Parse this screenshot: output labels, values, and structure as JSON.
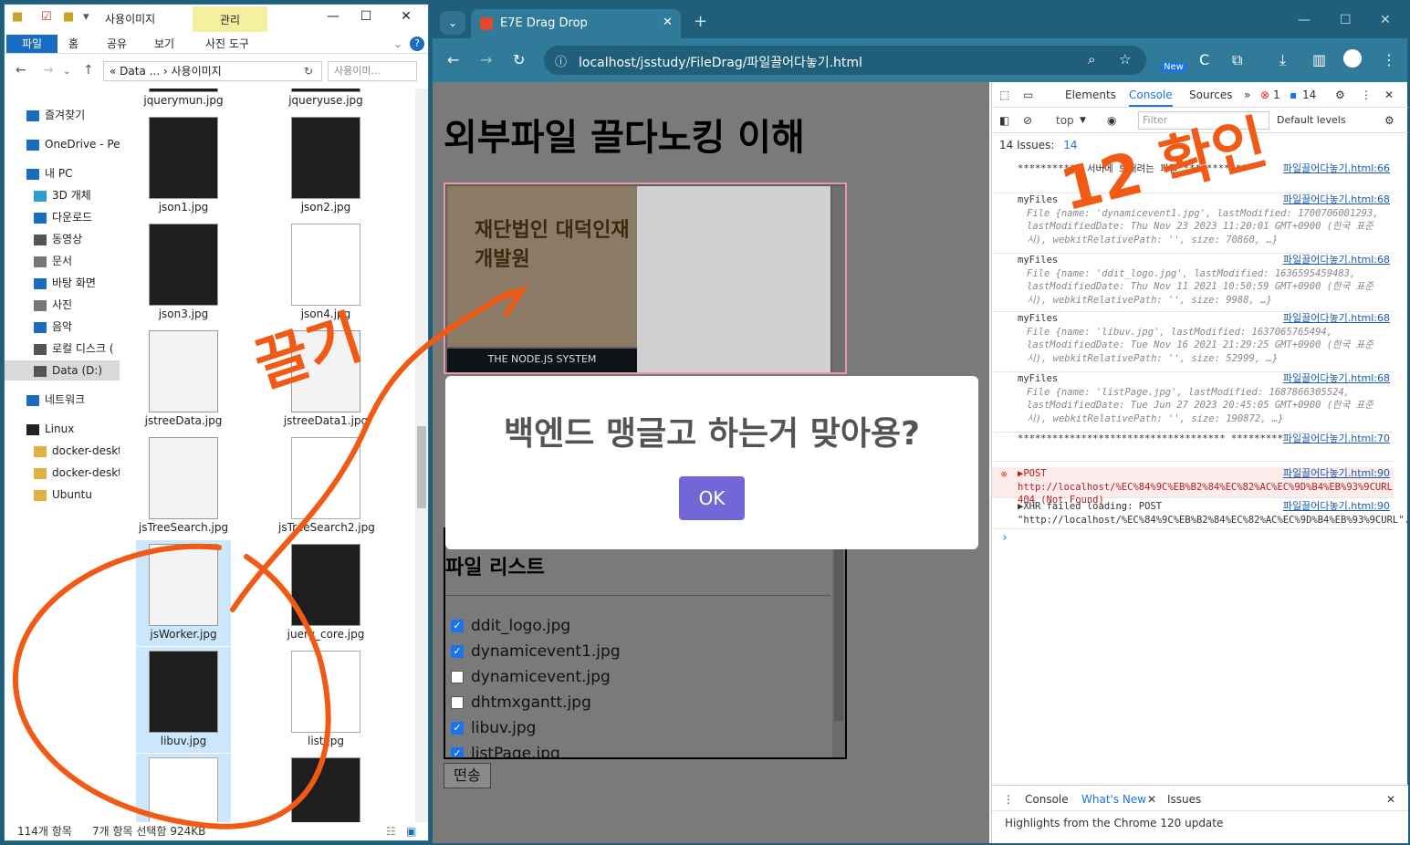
{
  "explorer": {
    "title": "사용이미지",
    "manage_tab": "관리",
    "ribbon_tabs": [
      "파일",
      "홈",
      "공유",
      "보기",
      "사진 도구"
    ],
    "address_crumbs": "«  Data ...  ›  사용이미지",
    "search_placeholder": "사용이미...",
    "nav_items": [
      "즐겨찾기",
      "OneDrive - Per",
      "내 PC",
      "3D 개체",
      "다운로드",
      "동영상",
      "문서",
      "바탕 화면",
      "사진",
      "음악",
      "로컬 디스크 (",
      "Data (D:)",
      "네트워크",
      "Linux",
      "docker-deskt",
      "docker-deskt",
      "Ubuntu"
    ],
    "files": [
      {
        "name": "jquerymun.jpg",
        "thumb": "dark"
      },
      {
        "name": "jqueryuse.jpg",
        "thumb": "dark"
      },
      {
        "name": "json1.jpg",
        "thumb": "dark"
      },
      {
        "name": "json2.jpg",
        "thumb": "dark"
      },
      {
        "name": "json3.jpg",
        "thumb": "dark"
      },
      {
        "name": "json4.jpg",
        "thumb": "doc"
      },
      {
        "name": "jstreeData.jpg",
        "thumb": "light"
      },
      {
        "name": "jstreeData1.jpg",
        "thumb": "light"
      },
      {
        "name": "jsTreeSearch.jpg",
        "thumb": "light"
      },
      {
        "name": "jsTreeSearch2.jpg",
        "thumb": "doc"
      },
      {
        "name": "jsWorker.jpg",
        "thumb": "light"
      },
      {
        "name": "juery_core.jpg",
        "thumb": "dark"
      },
      {
        "name": "libuv.jpg",
        "thumb": "dark"
      },
      {
        "name": "list.jpg",
        "thumb": "doc"
      },
      {
        "name": "",
        "thumb": "doc"
      },
      {
        "name": "",
        "thumb": "dark"
      }
    ],
    "status_count": "114개 항목",
    "status_selection": "7개 항목 선택함 924KB"
  },
  "browser": {
    "tab_title": "E7E Drag Drop",
    "url": "localhost/jsstudy/FileDrag/파일끌어다놓기.html",
    "new_badge": "New"
  },
  "page": {
    "title": "외부파일 끌다노킹 이해",
    "dropzone_logo_text": "재단법인 대덕인재개발원",
    "dropzone_caption": "THE NODE.JS SYSTEM",
    "list_heading": "파일 리스트",
    "file_list": [
      {
        "name": "ddit_logo.jpg",
        "checked": true
      },
      {
        "name": "dynamicevent1.jpg",
        "checked": true
      },
      {
        "name": "dynamicevent.jpg",
        "checked": false
      },
      {
        "name": "dhtmxgantt.jpg",
        "checked": false
      },
      {
        "name": "libuv.jpg",
        "checked": true
      },
      {
        "name": "listPage.jpg",
        "checked": true
      }
    ],
    "send_button": "떤송"
  },
  "dialog": {
    "message": "백엔드 맹글고 하는거 맞아용?",
    "ok_label": "OK"
  },
  "devtools": {
    "tabs": [
      "Elements",
      "Console",
      "Sources"
    ],
    "error_count": "1",
    "issue_count": "14",
    "context": "top",
    "filter_placeholder": "Filter",
    "levels": "Default levels",
    "issues_bar": "14 Issues:",
    "issues_bar_count": "14",
    "messages": [
      {
        "text": "*********** 서버에 보내려는 파일 ***********",
        "source": "파일끌어다놓기.html:66"
      },
      {
        "text": "myFiles",
        "detail": "File {name: 'dynamicevent1.jpg', lastModified: 1700706001293, lastModifiedDate: Thu Nov 23 2023 11:20:01 GMT+0900 (한국 표준시), webkitRelativePath: '', size: 70860, …}",
        "source": "파일끌어다놓기.html:68"
      },
      {
        "text": "myFiles",
        "detail": "File {name: 'ddit_logo.jpg', lastModified: 1636595459483, lastModifiedDate: Thu Nov 11 2021 10:50:59 GMT+0900 (한국 표준시), webkitRelativePath: '', size: 9988, …}",
        "source": "파일끌어다놓기.html:68"
      },
      {
        "text": "myFiles",
        "detail": "File {name: 'libuv.jpg', lastModified: 1637065765494, lastModifiedDate: Tue Nov 16 2021 21:29:25 GMT+0900 (한국 표준시), webkitRelativePath: '', size: 52999, …}",
        "source": "파일끌어다놓기.html:68"
      },
      {
        "text": "myFiles",
        "detail": "File {name: 'listPage.jpg', lastModified: 1687866305524, lastModifiedDate: Tue Jun 27 2023 20:45:05 GMT+0900 (한국 표준시), webkitRelativePath: '', size: 190872, …}",
        "source": "파일끌어다놓기.html:68"
      },
      {
        "text": "************************************ *********",
        "source": "파일끌어다놓기.html:70"
      }
    ],
    "error_message": "▶POST http://localhost/%EC%84%9C%EB%B2%84%EC%82%AC%EC%9D%B4%EB%93%9CURL 404 (Not Found)",
    "error_source": "파일끌어다놓기.html:90",
    "xhr_message": "▶XHR failed loading: POST \"http://localhost/%EC%84%9C%EB%B2%84%EC%82%AC%EC%9D%B4%EB%93%9CURL\".",
    "xhr_source": "파일끌어다놓기.html:90",
    "drawer_tabs": [
      "Console",
      "What's New",
      "Issues"
    ],
    "drawer_text": "Highlights from the Chrome 120 update"
  },
  "annotations": {
    "drag_label": "끌기",
    "check_label": "12 확인",
    "color": "#f05a14"
  }
}
